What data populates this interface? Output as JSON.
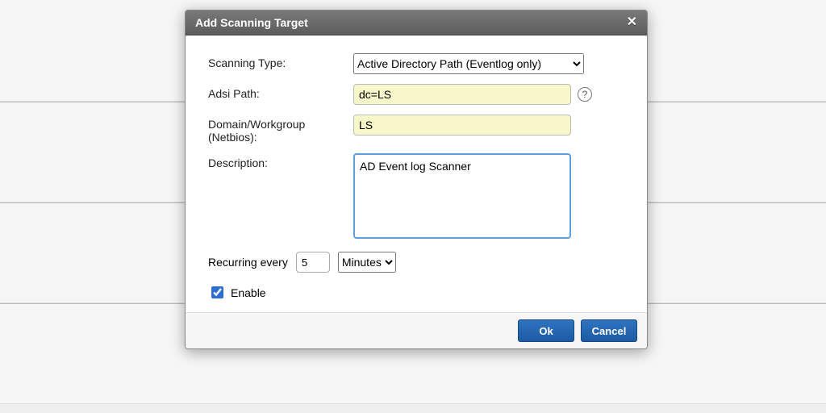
{
  "dialog": {
    "title": "Add Scanning Target",
    "labels": {
      "scanning_type": "Scanning Type:",
      "adsi_path": "Adsi Path:",
      "domain_workgroup": "Domain/Workgroup (Netbios):",
      "description": "Description:",
      "recurring": "Recurring every",
      "enable": "Enable"
    },
    "values": {
      "scanning_type": "Active Directory Path (Eventlog only)",
      "adsi_path": "dc=LS",
      "domain_workgroup": "LS",
      "description": "AD Event log Scanner",
      "recurring_value": "5",
      "recurring_unit": "Minutes",
      "enable_checked": true
    },
    "buttons": {
      "ok": "Ok",
      "cancel": "Cancel"
    }
  }
}
